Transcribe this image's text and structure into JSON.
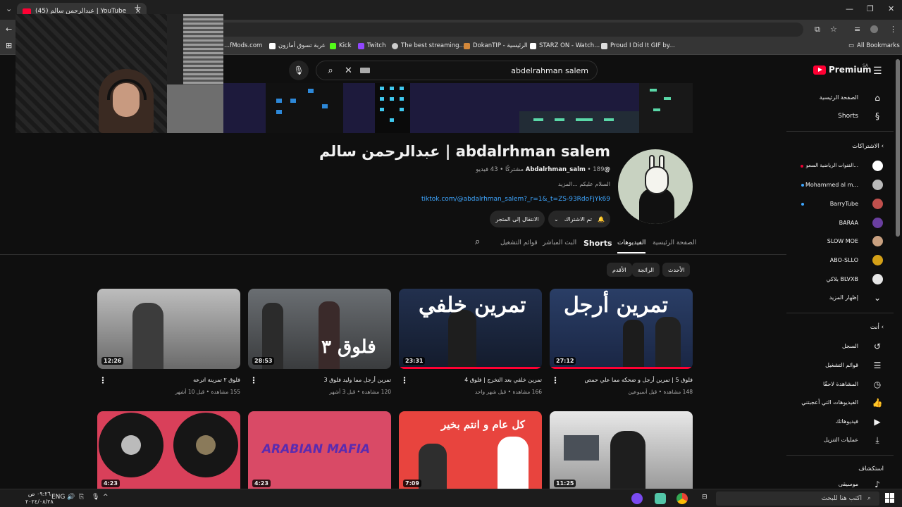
{
  "browser": {
    "tab_title": "(45) عبدالرحمن سالم | YouTube",
    "bookmarks": [
      {
        "label": "...fMods.com",
        "color": "#888888"
      },
      {
        "label": "عربة تسوق أمازون",
        "color": "#ffffff"
      },
      {
        "label": "Kick",
        "color": "#53fc18"
      },
      {
        "label": "Twitch",
        "color": "#9146ff"
      },
      {
        "label": "The best streaming...",
        "color": "#cccccc"
      },
      {
        "label": "DokanTIP - الرئيسية",
        "color": "#d4883a"
      },
      {
        "label": "STARZ ON - Watch...",
        "color": "#ffffff"
      },
      {
        "label": "Proud I Did It GIF by...",
        "color": "#dddddd"
      }
    ],
    "all_bookmarks": "All Bookmarks"
  },
  "search": {
    "query": "abdelrahman salem"
  },
  "channel": {
    "name": "عبدالرحمن سالم | abdalrhman salem",
    "handle": "@Abdalrhman_salm",
    "subscribers": "189 مشتركًا",
    "videos_count": "43 فيديو",
    "description": "السلام عليكم ...المزيد",
    "link": "tiktok.com/@abdalrhman_salem?_r=1&_t=ZS-93RdoFjYk69",
    "subscribed_label": "تم الاشتراك",
    "join_label": "الانتقال إلى المتجر"
  },
  "tabs": [
    "الصفحة الرئيسية",
    "الفيديوهات",
    "Shorts",
    "البث المباشر",
    "قوائم التشغيل"
  ],
  "chips": [
    "الأحدث",
    "الرائجة",
    "الأقدم"
  ],
  "videos": [
    {
      "title": "فلوق 5 | تمرين أرجل و ضحكه مما علي حمص",
      "meta": "148 مشاهدة • قبل أسبوعين",
      "duration": "27:12",
      "overlay": "تمرين أرجل"
    },
    {
      "title": "تمرين خلفي بعد التخرج | فلوق 4",
      "meta": "166 مشاهدة • قبل شهر واحد",
      "duration": "23:31",
      "overlay": "تمرين خلفي"
    },
    {
      "title": "تمرين أرجل مما وليد فلوق 3",
      "meta": "120 مشاهدة • قبل 3 أشهر",
      "duration": "28:53",
      "overlay": "فلوق ٣"
    },
    {
      "title": "فلوق ٢ تمرينة اترعه",
      "meta": "155 مشاهدة • قبل 10 أشهر",
      "duration": "12:26",
      "overlay": ""
    },
    {
      "title": "",
      "meta": "",
      "duration": "11:25",
      "overlay": ""
    },
    {
      "title": "",
      "meta": "",
      "duration": "7:09",
      "overlay": "كل عام و انتم بخير"
    },
    {
      "title": "",
      "meta": "",
      "duration": "4:23",
      "overlay": "ARABIAN MAFIA"
    },
    {
      "title": "",
      "meta": "",
      "duration": "4:23",
      "overlay": ""
    }
  ],
  "sidebar": {
    "brand": "Premium",
    "region": "SA",
    "main": [
      {
        "label": "الصفحة الرئيسية",
        "icon": "home-icon"
      },
      {
        "label": "Shorts",
        "icon": "shorts-icon"
      }
    ],
    "subscriptions_header": "الاشتراكات",
    "subscriptions": [
      {
        "label": "القنوات الرياضية السعو...",
        "color": "#ffffff"
      },
      {
        "label": "Mohammed al m...",
        "color": "#b9b9b9"
      },
      {
        "label": "BarryTube",
        "color": "#c0504d"
      },
      {
        "label": "BARAA",
        "color": "#6a3fa0"
      },
      {
        "label": "SLOW MOE",
        "color": "#c8a080"
      },
      {
        "label": "ABO-SLLO",
        "color": "#d4a017"
      },
      {
        "label": "بلاكي BLVXB",
        "color": "#e6e6e6"
      }
    ],
    "show_more": "إظهار المزيد",
    "you_header": "أنت",
    "you": [
      {
        "label": "السجل",
        "icon": "history-icon"
      },
      {
        "label": "قوائم التشغيل",
        "icon": "playlists-icon"
      },
      {
        "label": "المشاهدة لاحقًا",
        "icon": "watch-later-icon"
      },
      {
        "label": "الفيديوهات التي أعجبتني",
        "icon": "like-icon"
      },
      {
        "label": "فيديوهاتك",
        "icon": "your-videos-icon"
      },
      {
        "label": "عمليات التنزيل",
        "icon": "download-icon"
      }
    ],
    "explore_header": "استكشاف",
    "explore_first": "موسيقى"
  },
  "taskbar": {
    "search_placeholder": "اكتب هنا للبحث",
    "time": "٠٩:٢٦ ص",
    "date": "٢٠٢٤/٠٨/٢٨",
    "lang": "ENG"
  }
}
